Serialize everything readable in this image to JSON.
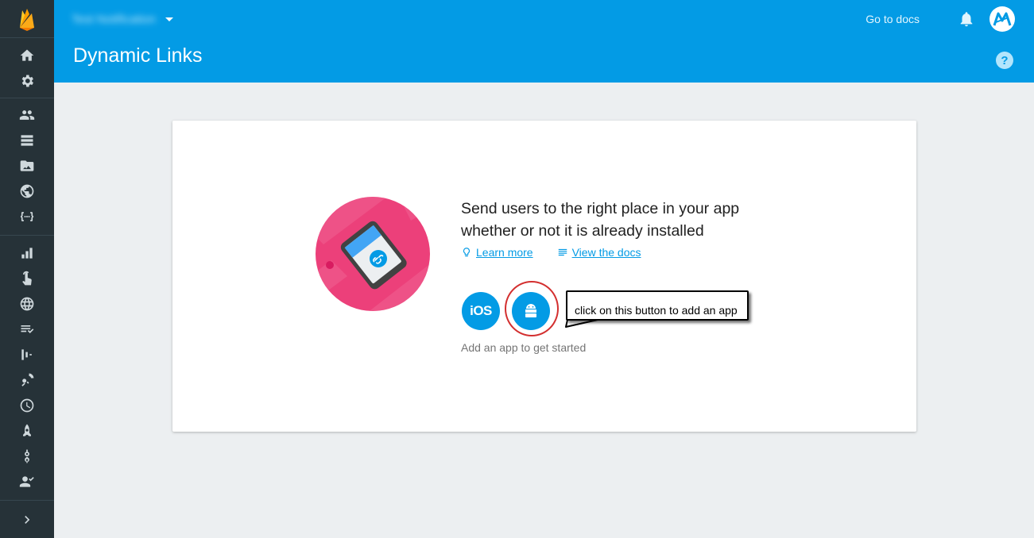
{
  "header": {
    "project_name": "Test Notification",
    "page_title": "Dynamic Links",
    "go_to_docs": "Go to docs"
  },
  "sidebar": {
    "items": [
      {
        "icon": "home-icon"
      },
      {
        "icon": "settings-icon"
      },
      {
        "icon": "authentication-icon"
      },
      {
        "icon": "database-icon"
      },
      {
        "icon": "storage-icon"
      },
      {
        "icon": "hosting-icon"
      },
      {
        "icon": "functions-icon"
      },
      {
        "icon": "analytics-icon"
      },
      {
        "icon": "events-icon"
      },
      {
        "icon": "globe-icon"
      },
      {
        "icon": "conversions-icon"
      },
      {
        "icon": "funnels-icon"
      },
      {
        "icon": "streamview-icon"
      },
      {
        "icon": "debugview-icon"
      },
      {
        "icon": "launch-icon"
      },
      {
        "icon": "predictions-icon"
      },
      {
        "icon": "audiences-icon"
      }
    ]
  },
  "main": {
    "headline": "Send users to the right place in your app whether or not it is already installed",
    "learn_more": "Learn more",
    "view_docs": "View the docs",
    "ios_label": "iOS",
    "hint": "Add an app to get started"
  },
  "annotation": {
    "text": "click on this button to add an app"
  },
  "colors": {
    "header": "#039be5",
    "rail": "#263238",
    "accent": "#039be5",
    "background": "#eceff1",
    "hero": "#ec407a",
    "highlight": "#d32f2f"
  }
}
